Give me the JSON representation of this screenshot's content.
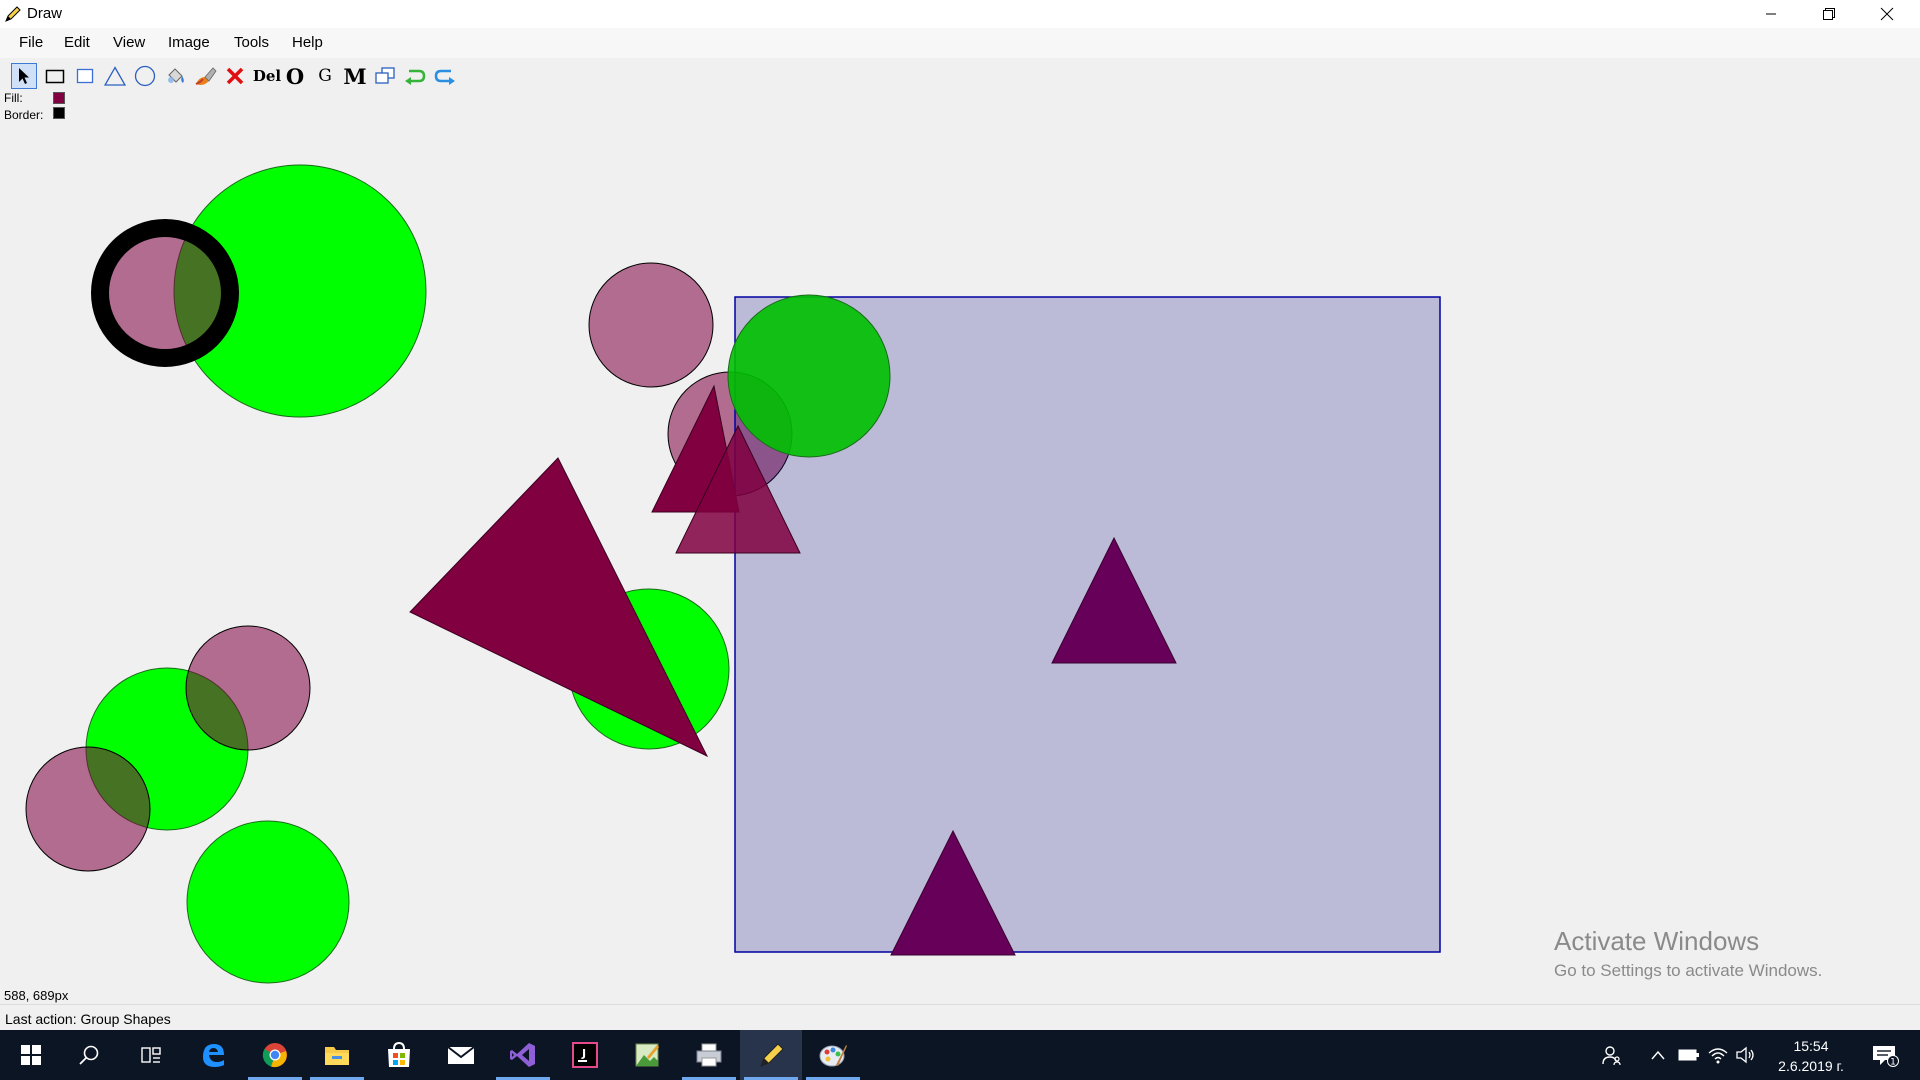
{
  "window": {
    "title": "Draw"
  },
  "menu": [
    "File",
    "Edit",
    "View",
    "Image",
    "Tools",
    "Help"
  ],
  "toolbar": {
    "tools": [
      "pointer-icon",
      "rectangle-icon",
      "square-icon",
      "triangle-icon",
      "ellipse-icon",
      "fill-bucket-icon",
      "brush-icon",
      "delete-x-icon",
      "Del",
      "O",
      "G",
      "M",
      "group-icon",
      "undo-icon",
      "redo-icon"
    ],
    "del_label": "Del",
    "o_label": "O",
    "g_label": "G",
    "m_label": "M"
  },
  "colors": {
    "fill_label": "Fill:",
    "border_label": "Border:",
    "fill": "#800040",
    "border": "#000000"
  },
  "canvas_shapes": [
    {
      "type": "circle",
      "fill": "#00ff00",
      "stroke": "#1a6a1a",
      "opacity": 1
    },
    {
      "type": "circle",
      "fill": "#800040",
      "stroke": "#000000",
      "opacity": 0.55
    },
    {
      "type": "circle",
      "fill": "#800040",
      "stroke": "#000000",
      "opacity": 0.55
    },
    {
      "type": "circle",
      "fill": "#800040",
      "stroke": "#000000",
      "opacity": 0.55
    },
    {
      "type": "rect",
      "fill": "#000080",
      "stroke": "#0000a0",
      "opacity": 0.22
    },
    {
      "type": "circle",
      "fill": "#00c000",
      "stroke": "#1a6a1a",
      "opacity": 0.9
    },
    {
      "type": "triangle",
      "fill": "#800040",
      "stroke": "#3a0020",
      "opacity": 1
    },
    {
      "type": "triangle",
      "fill": "#800040",
      "stroke": "#3a0020",
      "opacity": 0.85
    },
    {
      "type": "circle",
      "fill": "#00ff00",
      "stroke": "#1a6a1a",
      "opacity": 1
    },
    {
      "type": "triangle",
      "fill": "#800040",
      "stroke": "#3a0020",
      "opacity": 1
    },
    {
      "type": "triangle",
      "fill": "#660058",
      "stroke": "#3a0030",
      "opacity": 1
    },
    {
      "type": "triangle",
      "fill": "#660058",
      "stroke": "#3a0030",
      "opacity": 1
    },
    {
      "type": "circle",
      "fill": "#00ff00",
      "stroke": "#1a6a1a",
      "opacity": 1
    },
    {
      "type": "circle",
      "fill": "#800040",
      "stroke": "#000000",
      "opacity": 0.55
    },
    {
      "type": "circle",
      "fill": "#800040",
      "stroke": "#000000",
      "opacity": 0.55
    },
    {
      "type": "circle",
      "fill": "#00ff00",
      "stroke": "#1a6a1a",
      "opacity": 1
    }
  ],
  "watermark": {
    "line1": "Activate Windows",
    "line2": "Go to Settings to activate Windows."
  },
  "status": {
    "coordinates": "588, 689px",
    "last_action": "Last action: Group Shapes"
  },
  "taskbar": {
    "items": [
      "windows-start-icon",
      "search-icon",
      "task-view-icon",
      "edge-icon",
      "chrome-icon",
      "file-explorer-icon",
      "store-icon",
      "mail-icon",
      "visual-studio-icon",
      "jetbrains-icon",
      "image-editor-icon",
      "printer-app-icon",
      "draw-app-icon",
      "paint-app-icon"
    ],
    "time": "15:54",
    "date": "2.6.2019 г.",
    "notification_count": "1"
  }
}
